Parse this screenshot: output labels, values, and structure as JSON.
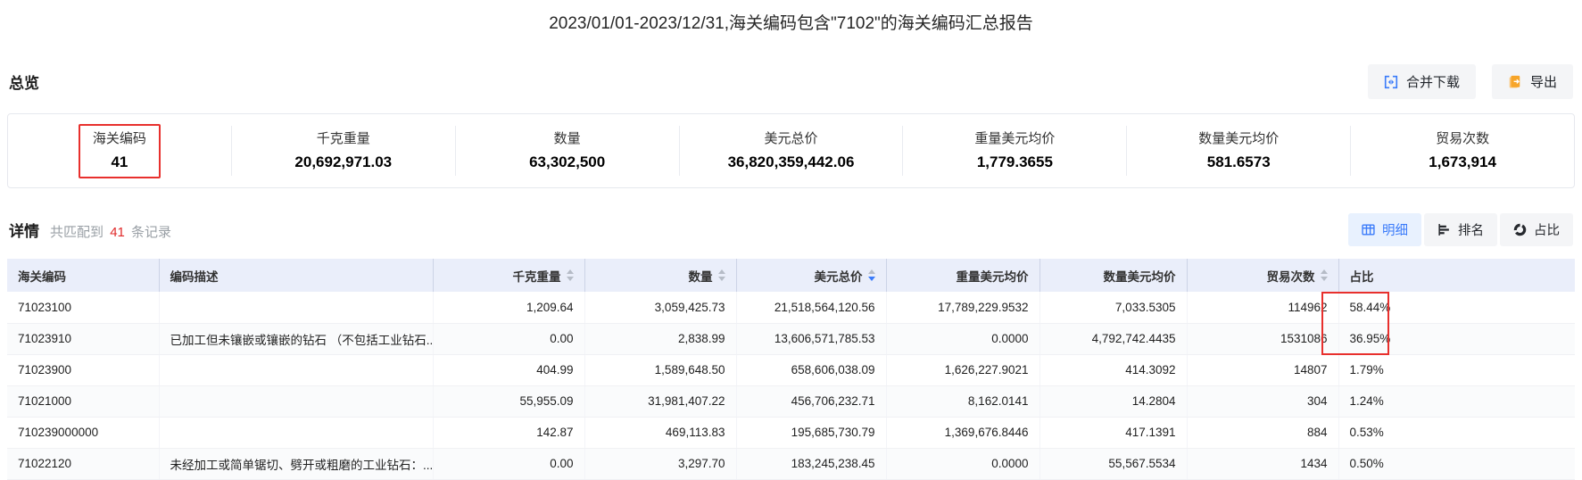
{
  "title": "2023/01/01-2023/12/31,海关编码包含\"7102\"的海关编码汇总报告",
  "overview": {
    "heading": "总览",
    "merge_download_label": "合并下载",
    "export_label": "导出",
    "stats": [
      {
        "label": "海关编码",
        "value": "41",
        "highlighted": true
      },
      {
        "label": "千克重量",
        "value": "20,692,971.03"
      },
      {
        "label": "数量",
        "value": "63,302,500"
      },
      {
        "label": "美元总价",
        "value": "36,820,359,442.06"
      },
      {
        "label": "重量美元均价",
        "value": "1,779.3655"
      },
      {
        "label": "数量美元均价",
        "value": "581.6573"
      },
      {
        "label": "贸易次数",
        "value": "1,673,914"
      }
    ]
  },
  "detail": {
    "heading": "详情",
    "match_prefix": "共匹配到",
    "match_count": "41",
    "match_suffix": "条记录",
    "view_buttons": [
      {
        "label": "明细",
        "icon": "table-icon",
        "active": true
      },
      {
        "label": "排名",
        "icon": "ranking-icon",
        "active": false
      },
      {
        "label": "占比",
        "icon": "pie-icon",
        "active": false
      }
    ]
  },
  "table": {
    "columns": [
      {
        "label": "海关编码",
        "sortable": false,
        "align": "left"
      },
      {
        "label": "编码描述",
        "sortable": false,
        "align": "left"
      },
      {
        "label": "千克重量",
        "sortable": true,
        "align": "right"
      },
      {
        "label": "数量",
        "sortable": true,
        "align": "right"
      },
      {
        "label": "美元总价",
        "sortable": true,
        "align": "right",
        "sort": "desc"
      },
      {
        "label": "重量美元均价",
        "sortable": false,
        "align": "right"
      },
      {
        "label": "数量美元均价",
        "sortable": false,
        "align": "right"
      },
      {
        "label": "贸易次数",
        "sortable": true,
        "align": "right"
      },
      {
        "label": "占比",
        "sortable": false,
        "align": "left"
      }
    ],
    "rows": [
      [
        "71023100",
        "",
        "1,209.64",
        "3,059,425.73",
        "21,518,564,120.56",
        "17,789,229.9532",
        "7,033.5305",
        "114962",
        "58.44%"
      ],
      [
        "71023910",
        "已加工但未镶嵌或镶嵌的钻石 （不包括工业钻石...",
        "0.00",
        "2,838.99",
        "13,606,571,785.53",
        "0.0000",
        "4,792,742.4435",
        "1531086",
        "36.95%"
      ],
      [
        "71023900",
        "",
        "404.99",
        "1,589,648.50",
        "658,606,038.09",
        "1,626,227.9021",
        "414.3092",
        "14807",
        "1.79%"
      ],
      [
        "71021000",
        "",
        "55,955.09",
        "31,981,407.22",
        "456,706,232.71",
        "8,162.0141",
        "14.2804",
        "304",
        "1.24%"
      ],
      [
        "710239000000",
        "",
        "142.87",
        "469,113.83",
        "195,685,730.79",
        "1,369,676.8446",
        "417.1391",
        "884",
        "0.53%"
      ],
      [
        "71022120",
        "未经加工或简单锯切、劈开或粗磨的工业钻石：...",
        "0.00",
        "3,297.70",
        "183,245,238.45",
        "0.0000",
        "55,567.5534",
        "1434",
        "0.50%"
      ]
    ]
  },
  "colors": {
    "accent_blue": "#3a7bfa",
    "export_orange": "#f7a529",
    "annotation_red": "#e8302d",
    "count_red": "#e02a2a",
    "table_header_bg": "#eaeefa"
  }
}
